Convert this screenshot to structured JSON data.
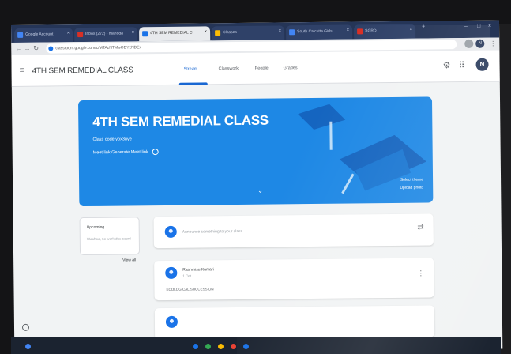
{
  "browser": {
    "tabs": [
      {
        "label": "Google Account"
      },
      {
        "label": "Inbox (272) - manoda"
      },
      {
        "label": "4TH SEM REMEDIAL C"
      },
      {
        "label": "Classes"
      },
      {
        "label": "South Calcutta Girls"
      },
      {
        "label": "SGRD"
      }
    ],
    "url": "classroom.google.com/c/MTAzNTMwODYzNDEx",
    "profile_initial": "N"
  },
  "app": {
    "menu_icon": "hamburger-icon",
    "title": "4TH SEM REMEDIAL CLASS",
    "tabs": [
      "Stream",
      "Classwork",
      "People",
      "Grades"
    ],
    "active_tab": "Stream",
    "avatar_initial": "N"
  },
  "banner": {
    "title": "4TH SEM REMEDIAL CLASS",
    "class_code": "Class code  yox3uye",
    "meet_link": "Meet link  Generate Meet link",
    "select_theme": "Select theme",
    "upload_photo": "Upload photo",
    "color": "#1e88e5"
  },
  "upcoming": {
    "title": "Upcoming",
    "subtitle": "Woohoo, no work due soon!",
    "view_all": "View all"
  },
  "announce": {
    "placeholder": "Announce something to your class"
  },
  "post": {
    "author": "Rashmisu Kumari",
    "date": "1 Oct",
    "body": "ECOLOGICAL SUCCESSION"
  }
}
